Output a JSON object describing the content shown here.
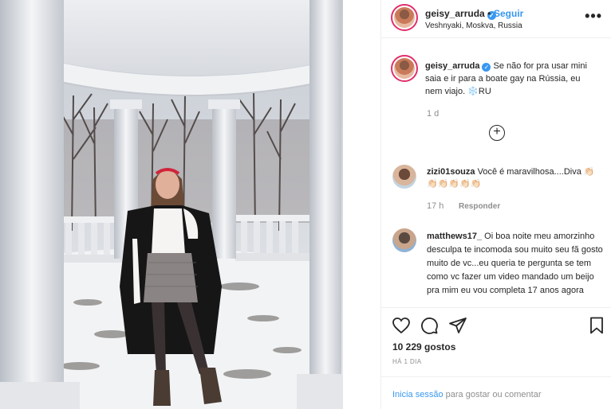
{
  "header": {
    "username": "geisy_arruda",
    "verified": "✓",
    "separator": "•",
    "follow_label": "Seguir",
    "location": "Veshnyaki, Moskva, Russia",
    "more_label": "•••"
  },
  "caption": {
    "username": "geisy_arruda",
    "verified": "✓",
    "text": "Se não for pra usar mini saia e ir para a boate gay na Rússia, eu nem viajo. ❄️RU",
    "time": "1 d",
    "load_more": "+"
  },
  "comments": [
    {
      "username": "zizi01souza",
      "text": "Você é maravilhosa....Diva 👏🏻👏🏻👏🏻👏🏻👏🏻👏🏻",
      "time": "17 h",
      "reply_label": "Responder"
    },
    {
      "username": "matthews17_",
      "text": "Oi boa noite meu amorzinho desculpa te incomoda sou muito seu fã gosto muito de vc...eu queria te pergunta se tem como vc fazer um video mandado um beijo pra mim eu vou completa 17 anos agora"
    }
  ],
  "actions": {
    "likes": "10 229 gostos",
    "date": "HÁ 1 DIA"
  },
  "login": {
    "link": "Inicia sessão",
    "rest": " para gostar ou comentar"
  },
  "icons": {
    "like": "heart-icon",
    "comment": "comment-icon",
    "share": "paper-plane-icon",
    "save": "bookmark-icon",
    "more": "more-dots-icon",
    "load_more": "plus-circle-icon"
  }
}
